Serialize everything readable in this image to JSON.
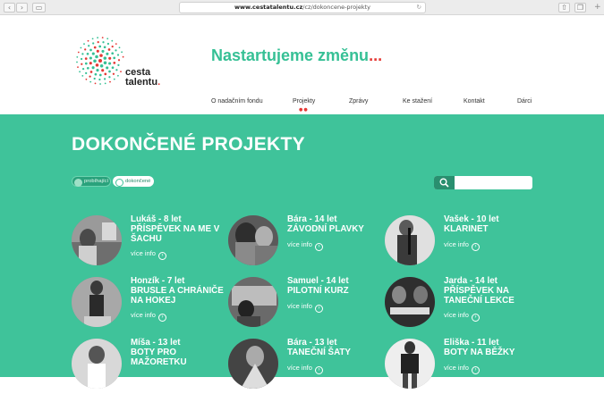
{
  "browser": {
    "url_domain": "www.cestatalentu.cz",
    "url_path": "/cz/dokoncene-projekty"
  },
  "header": {
    "logo_line1": "cesta",
    "logo_line2": "talentu",
    "tagline": "Nastartujeme změnu",
    "tagline_dots": "...",
    "nav": [
      {
        "label": "O nadačním fondu"
      },
      {
        "label": "Projekty"
      },
      {
        "label": "Zprávy"
      },
      {
        "label": "Ke stažení"
      },
      {
        "label": "Kontakt"
      },
      {
        "label": "Dárci"
      }
    ]
  },
  "main": {
    "title": "DOKONČENÉ PROJEKTY",
    "filters": [
      {
        "label": "probíhající"
      },
      {
        "label": "dokončené"
      }
    ],
    "search_placeholder": "",
    "more_label": "více info",
    "projects": [
      {
        "line1": "Lukáš - 8 let",
        "line2": "PŘÍSPĚVEK NA ME V",
        "line3": "ŠACHU"
      },
      {
        "line1": "Bára - 14 let",
        "line2": "ZÁVODNÍ PLAVKY",
        "line3": ""
      },
      {
        "line1": "Vašek - 10 let",
        "line2": "KLARINET",
        "line3": ""
      },
      {
        "line1": "Honzík - 7 let",
        "line2": "BRUSLE A CHRÁNIČE",
        "line3": "NA HOKEJ"
      },
      {
        "line1": "Samuel - 14 let",
        "line2": "PILOTNÍ KURZ",
        "line3": ""
      },
      {
        "line1": "Jarda - 14 let",
        "line2": "PŘÍSPĚVEK NA",
        "line3": "TANEČNÍ LEKCE"
      },
      {
        "line1": "Míša - 13 let",
        "line2": "BOTY PRO",
        "line3": "MAŽORETKU"
      },
      {
        "line1": "Bára - 13 let",
        "line2": "TANEČNÍ ŠATY",
        "line3": ""
      },
      {
        "line1": "Eliška - 11 let",
        "line2": "BOTY NA BĚŽKY",
        "line3": ""
      }
    ]
  },
  "colors": {
    "brand_green": "#3fc39a",
    "accent_red": "#e53935"
  }
}
